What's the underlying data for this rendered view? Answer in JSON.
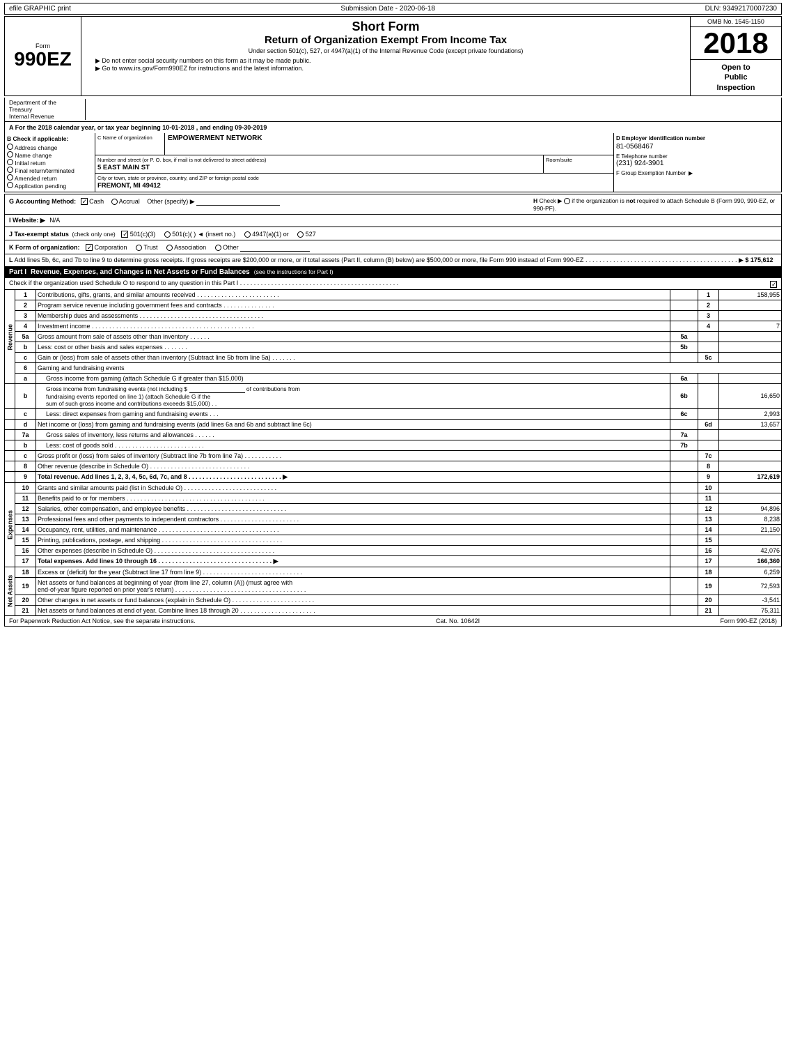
{
  "topBar": {
    "left": "efile GRAPHIC print",
    "middle": "Submission Date - 2020-06-18",
    "right": "DLN: 93492170007230"
  },
  "header": {
    "formLabel": "Form",
    "formNumber": "990EZ",
    "shortFormTitle": "Short Form",
    "returnTitle": "Return of Organization Exempt From Income Tax",
    "underSection": "Under section 501(c), 527, or 4947(a)(1) of the Internal Revenue Code (except private foundations)",
    "notice1": "▶ Do not enter social security numbers on this form as it may be made public.",
    "notice2": "▶ Go to www.irs.gov/Form990EZ for instructions and the latest information.",
    "ombNumber": "OMB No. 1545-1150",
    "year": "2018",
    "openToPublic": "Open to\nPublic\nInspection"
  },
  "dept": {
    "lines": [
      "Department of the",
      "Treasury",
      "Internal Revenue"
    ]
  },
  "sectionA": {
    "text": "A  For the 2018 calendar year, or tax year beginning 10-01-2018        , and ending 09-30-2019"
  },
  "checkBoxes": {
    "B_label": "B  Check if applicable:",
    "items": [
      "Address change",
      "Name change",
      "Initial return",
      "Final return/terminated",
      "Amended return",
      "Application pending"
    ]
  },
  "orgInfo": {
    "C_label": "C Name of organization",
    "orgName": "EMPOWERMENT NETWORK",
    "addressLabel": "Number and street (or P. O. box, if mail is not delivered to street address)",
    "address": "5 EAST MAIN ST",
    "roomSuiteLabel": "Room/suite",
    "cityLabel": "City or town, state or province, country, and ZIP or foreign postal code",
    "city": "FREMONT, MI  49412",
    "D_label": "D Employer identification number",
    "ein": "81-0568467",
    "E_label": "E Telephone number",
    "phone": "(231) 924-3901",
    "F_label": "F Group Exemption\nNumber",
    "groupNum": ""
  },
  "accountingMethod": {
    "G_label": "G Accounting Method:",
    "cash": "Cash",
    "accrual": "Accrual",
    "other": "Other (specify) ▶",
    "H_label": "H  Check ▶",
    "H_text": "○  if the organization is not required to attach Schedule B (Form 990, 990-EZ, or 990-PF)."
  },
  "website": {
    "label": "I Website: ▶",
    "value": "N/A"
  },
  "taxExempt": {
    "label": "J Tax-exempt status",
    "checkOnly": "(check only one)",
    "options": [
      "☑ 501(c)(3)",
      "○ 501(c)(  )  ◄ (insert no.)",
      "○ 4947(a)(1) or",
      "○ 527"
    ]
  },
  "formOfOrg": {
    "label": "K Form of organization:",
    "options": [
      "☑ Corporation",
      "○ Trust",
      "○ Association",
      "○ Other"
    ]
  },
  "addLines": {
    "text": "L Add lines 5b, 6c, and 7b to line 9 to determine gross receipts. If gross receipts are $200,000 or more, or if total assets (Part II, column (B) below) are $500,000 or more, file Form 990 instead of Form 990-EZ",
    "dots": ". . . . . . . . . . . . . . . . . . . . . . . . . . . . . . . . . . . . . . . . . . . . ▶",
    "value": "$ 175,612"
  },
  "partI": {
    "label": "Part I",
    "title": "Revenue, Expenses, and Changes in Net Assets or Fund Balances",
    "subtitleNote": "(see the instructions for Part I)",
    "scheduleOCheck": "Check if the organization used Schedule O to respond to any question in this Part I . . . . . . . . . . . . . . . . . . . . . . . . . . . ☑",
    "rows": [
      {
        "num": "1",
        "desc": "Contributions, gifts, grants, and similar amounts received",
        "dots": ". . . . . . . . . . . . . . . . . . . . . . . .",
        "lineNum": "1",
        "value": "158,955",
        "indent": 0
      },
      {
        "num": "2",
        "desc": "Program service revenue including government fees and contracts",
        "dots": ". . . . . . . . . . . . . . .",
        "lineNum": "2",
        "value": "",
        "indent": 0
      },
      {
        "num": "3",
        "desc": "Membership dues and assessments",
        "dots": ". . . . . . . . . . . . . . . . . . . . . . . . . . . . . . . . . . . .",
        "lineNum": "3",
        "value": "",
        "indent": 0
      },
      {
        "num": "4",
        "desc": "Investment income",
        "dots": ". . . . . . . . . . . . . . . . . . . . . . . . . . . . . . . . . . . . . . . . . . . . . . .",
        "lineNum": "4",
        "value": "7",
        "indent": 0
      },
      {
        "num": "5a",
        "desc": "Gross amount from sale of assets other than inventory",
        "dots": ". . . . . .",
        "midNum": "5a",
        "lineNum": "",
        "value": "",
        "indent": 0
      },
      {
        "num": "5b",
        "desc": "Less: cost or other basis and sales expenses",
        "dots": ". . . . . . .",
        "midNum": "5b",
        "lineNum": "",
        "value": "",
        "indent": 2
      },
      {
        "num": "5c",
        "desc": "Gain or (loss) from sale of assets other than inventory (Subtract line 5b from line 5a)",
        "dots": ". . . . . . .",
        "lineNum": "5c",
        "value": "",
        "indent": 0
      },
      {
        "num": "6",
        "desc": "Gaming and fundraising events",
        "dots": "",
        "lineNum": "",
        "value": "",
        "indent": 0
      },
      {
        "num": "6a",
        "desc": "Gross income from gaming (attach Schedule G if greater than $15,000)",
        "midNum": "6a",
        "dots": "",
        "lineNum": "",
        "value": "",
        "indent": 2
      },
      {
        "num": "6b",
        "desc": "Gross income from fundraising events (not including $",
        "descCont": "_______________ of contributions from fundraising events reported on line 1) (attach Schedule G if the sum of such gross income and contributions exceeds $15,000)",
        "midNum": "6b",
        "lineNum": "",
        "value": "16,650",
        "indent": 2
      },
      {
        "num": "6c",
        "desc": "Less: direct expenses from gaming and fundraising events",
        "dots": ". . .",
        "midNum": "6c",
        "lineNum": "",
        "value": "2,993",
        "indent": 2
      },
      {
        "num": "6d",
        "desc": "Net income or (loss) from gaming and fundraising events (add lines 6a and 6b and subtract line 6c)",
        "dots": "",
        "lineNum": "6d",
        "value": "13,657",
        "indent": 0
      },
      {
        "num": "7a",
        "desc": "Gross sales of inventory, less returns and allowances",
        "dots": ". . . . . .",
        "midNum": "7a",
        "lineNum": "",
        "value": "",
        "indent": 2
      },
      {
        "num": "7b",
        "desc": "Less: cost of goods sold",
        "dots": ". . . . . . . . . . . . . . . . . . . . . . . . . .",
        "midNum": "7b",
        "lineNum": "",
        "value": "",
        "indent": 2
      },
      {
        "num": "7c",
        "desc": "Gross profit or (loss) from sales of inventory (Subtract line 7b from line 7a)",
        "dots": ". . . . . . . . . . .",
        "lineNum": "7c",
        "value": "",
        "indent": 0
      },
      {
        "num": "8",
        "desc": "Other revenue (describe in Schedule O)",
        "dots": ". . . . . . . . . . . . . . . . . . . . . . . . . . . . .",
        "lineNum": "8",
        "value": "",
        "indent": 0
      },
      {
        "num": "9",
        "desc": "Total revenue. Add lines 1, 2, 3, 4, 5c, 6d, 7c, and 8",
        "dots": ". . . . . . . . . . . . . . . . . . . . . . . . . . . ▶",
        "lineNum": "9",
        "value": "172,619",
        "bold": true,
        "indent": 0
      },
      {
        "num": "10",
        "desc": "Grants and similar amounts paid (list in Schedule O)",
        "dots": ". . . . . . . . . . . . . . . . . . . . . . . . . . .",
        "lineNum": "10",
        "value": "",
        "indent": 0
      },
      {
        "num": "11",
        "desc": "Benefits paid to or for members",
        "dots": ". . . . . . . . . . . . . . . . . . . . . . . . . . . . . . . . . . . . . . . . .",
        "lineNum": "11",
        "value": "",
        "indent": 0
      },
      {
        "num": "12",
        "desc": "Salaries, other compensation, and employee benefits",
        "dots": ". . . . . . . . . . . . . . . . . . . . . . . . . . . . . .",
        "lineNum": "12",
        "value": "94,896",
        "indent": 0
      },
      {
        "num": "13",
        "desc": "Professional fees and other payments to independent contractors",
        "dots": ". . . . . . . . . . . . . . . . . . . . . . . .",
        "lineNum": "13",
        "value": "8,238",
        "indent": 0
      },
      {
        "num": "14",
        "desc": "Occupancy, rent, utilities, and maintenance",
        "dots": ". . . . . . . . . . . . . . . . . . . . . . . . . . . . . . . . . . . .",
        "lineNum": "14",
        "value": "21,150",
        "indent": 0
      },
      {
        "num": "15",
        "desc": "Printing, publications, postage, and shipping",
        "dots": ". . . . . . . . . . . . . . . . . . . . . . . . . . . . . . . . . . . . . .",
        "lineNum": "15",
        "value": "",
        "indent": 0
      },
      {
        "num": "16",
        "desc": "Other expenses (describe in Schedule O)",
        "dots": ". . . . . . . . . . . . . . . . . . . . . . . . . . . . . . . . . . . .",
        "lineNum": "16",
        "value": "42,076",
        "indent": 0
      },
      {
        "num": "17",
        "desc": "Total expenses. Add lines 10 through 16",
        "dots": ". . . . . . . . . . . . . . . . . . . . . . . . . . . . . . . . . ▶",
        "lineNum": "17",
        "value": "166,360",
        "bold": true,
        "indent": 0
      },
      {
        "num": "18",
        "desc": "Excess or (deficit) for the year (Subtract line 17 from line 9)",
        "dots": ". . . . . . . . . . . . . . . . . . . . . . . . . . . . . .",
        "lineNum": "18",
        "value": "6,259",
        "indent": 0
      },
      {
        "num": "19",
        "desc": "Net assets or fund balances at beginning of year (from line 27, column (A)) (must agree with end-of-year figure reported on prior year's return)",
        "dots": ". . . . . . . . . . . . . . . . . . . . . . . . . . . . . . . . . . . . .",
        "lineNum": "19",
        "value": "72,593",
        "indent": 0
      },
      {
        "num": "20",
        "desc": "Other changes in net assets or fund balances (explain in Schedule O)",
        "dots": ". . . . . . . . . . . . . . . . . . . . . . . . . .",
        "lineNum": "20",
        "value": "-3,541",
        "indent": 0
      },
      {
        "num": "21",
        "desc": "Net assets or fund balances at end of year. Combine lines 18 through 20",
        "dots": ". . . . . . . . . . . . . . . . . . . . . . .",
        "lineNum": "21",
        "value": "75,311",
        "indent": 0
      }
    ],
    "revenueSideLabel": "Revenue",
    "expensesSideLabel": "Expenses",
    "netAssetsSideLabel": "Net Assets"
  },
  "footer": {
    "left": "For Paperwork Reduction Act Notice, see the separate instructions.",
    "middle": "Cat. No. 10642I",
    "right": "Form 990-EZ (2018)"
  }
}
